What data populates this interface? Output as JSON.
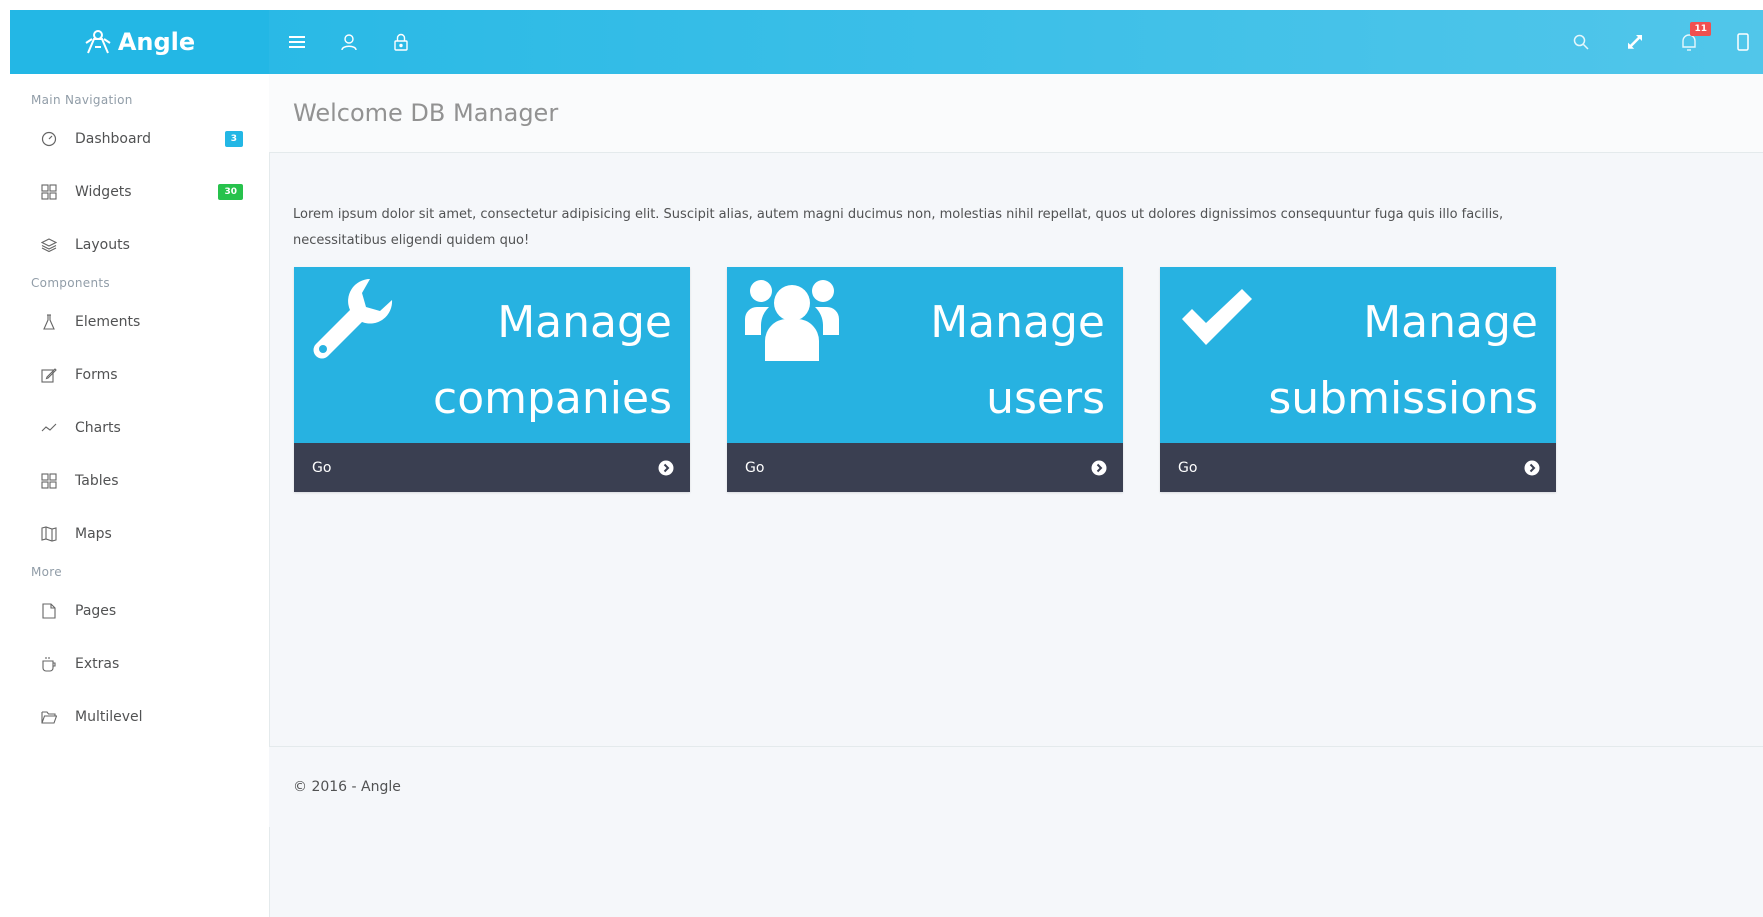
{
  "brand": {
    "name": "Angle"
  },
  "topbar": {
    "left_icons": [
      "menu-icon",
      "user-icon",
      "lock-icon"
    ],
    "right_icons": [
      "search-icon",
      "expand-icon",
      "bell-icon",
      "sidebar-toggle-icon"
    ],
    "notifications_count": "11"
  },
  "sidebar": {
    "sections": [
      {
        "heading": "Main Navigation",
        "items": [
          {
            "label": "Dashboard",
            "icon": "speedometer-icon",
            "badge": "3"
          },
          {
            "label": "Widgets",
            "icon": "grid-icon",
            "badge": "30"
          },
          {
            "label": "Layouts",
            "icon": "layers-icon",
            "badge": ""
          }
        ]
      },
      {
        "heading": "Components",
        "items": [
          {
            "label": "Elements",
            "icon": "chemistry-icon"
          },
          {
            "label": "Forms",
            "icon": "note-icon"
          },
          {
            "label": "Charts",
            "icon": "graph-icon"
          },
          {
            "label": "Tables",
            "icon": "grid-icon"
          },
          {
            "label": "Maps",
            "icon": "map-icon"
          }
        ]
      },
      {
        "heading": "More",
        "items": [
          {
            "label": "Pages",
            "icon": "doc-icon"
          },
          {
            "label": "Extras",
            "icon": "cup-icon"
          },
          {
            "label": "Multilevel",
            "icon": "folder-icon"
          }
        ]
      }
    ]
  },
  "main": {
    "heading": "Welcome DB Manager",
    "lead": "Lorem ipsum dolor sit amet, consectetur adipisicing elit. Suscipit alias, autem magni ducimus non, molestias nihil repellat, quos ut dolores dignissimos consequuntur fuga quis illo facilis, necessitatibus eligendi quidem quo!",
    "cards": [
      {
        "line1": "Manage",
        "line2": "companies",
        "icon": "wrench-icon",
        "footer": "Go"
      },
      {
        "line1": "Manage",
        "line2": "users",
        "icon": "users-icon",
        "footer": "Go"
      },
      {
        "line1": "Manage",
        "line2": "submissions",
        "icon": "check-icon",
        "footer": "Go"
      }
    ]
  },
  "footer": {
    "text": "© 2016 - Angle"
  },
  "colors": {
    "primary": "#23b7e5",
    "card": "#27b2e1",
    "card_footer": "#3a3f51",
    "success": "#27c24c",
    "danger": "#f05050"
  }
}
